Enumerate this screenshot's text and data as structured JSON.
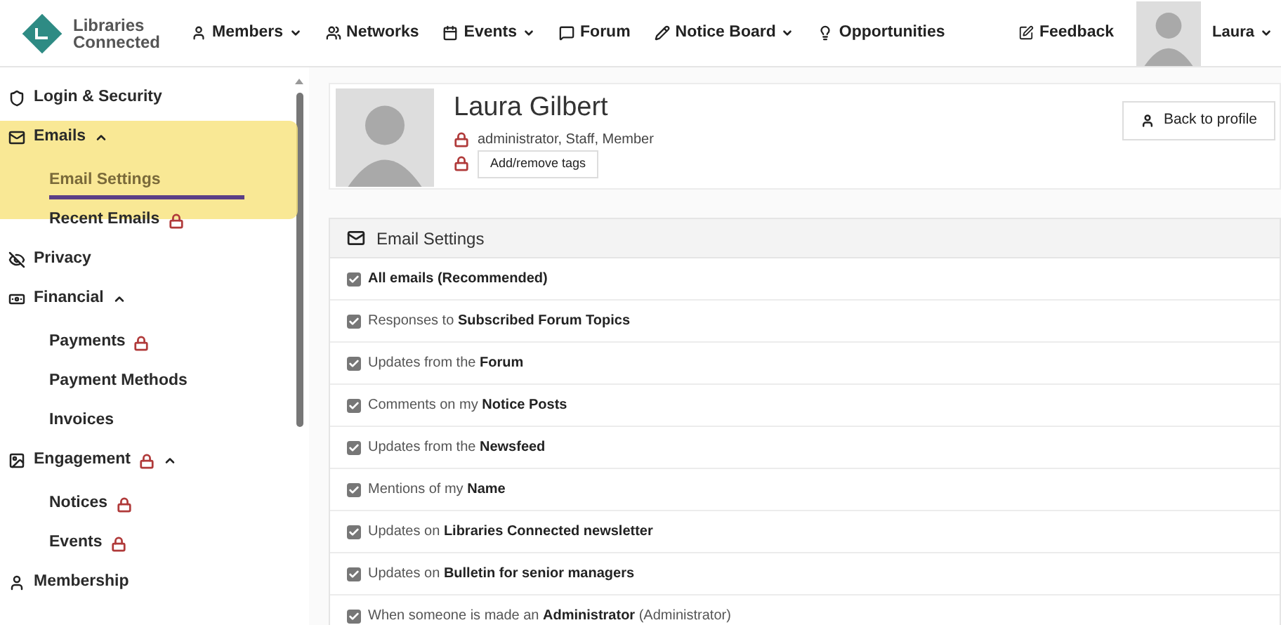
{
  "logo": {
    "line1": "Libraries",
    "line2": "Connected"
  },
  "nav": [
    {
      "label": "Members",
      "dropdown": true
    },
    {
      "label": "Networks",
      "dropdown": false
    },
    {
      "label": "Events",
      "dropdown": true
    },
    {
      "label": "Forum",
      "dropdown": false
    },
    {
      "label": "Notice Board",
      "dropdown": true
    },
    {
      "label": "Opportunities",
      "dropdown": false
    }
  ],
  "feedback": "Feedback",
  "user": {
    "name": "Laura"
  },
  "sidebar": {
    "items": [
      {
        "label": "Login & Security",
        "locked": false,
        "selected": false
      },
      {
        "label": "Emails",
        "locked": false,
        "expanded": true,
        "highlighted": true,
        "selected": false,
        "children": [
          {
            "label": "Email Settings",
            "locked": false,
            "selected": true
          },
          {
            "label": "Recent Emails",
            "locked": true,
            "selected": false
          }
        ]
      },
      {
        "label": "Privacy",
        "locked": false,
        "selected": false
      },
      {
        "label": "Financial",
        "locked": false,
        "expanded": true,
        "selected": false,
        "children": [
          {
            "label": "Payments",
            "locked": true,
            "selected": false
          },
          {
            "label": "Payment Methods",
            "locked": false,
            "selected": false
          },
          {
            "label": "Invoices",
            "locked": false,
            "selected": false
          }
        ]
      },
      {
        "label": "Engagement",
        "locked": true,
        "expanded": true,
        "selected": false,
        "children": [
          {
            "label": "Notices",
            "locked": true,
            "selected": false
          },
          {
            "label": "Events",
            "locked": true,
            "selected": false
          }
        ]
      },
      {
        "label": "Membership",
        "locked": false,
        "selected": false
      }
    ]
  },
  "profile": {
    "name": "Laura Gilbert",
    "tags": "administrator, Staff, Member",
    "tags_button": "Add/remove tags",
    "back_button": "Back to profile"
  },
  "email_settings": {
    "title": "Email Settings",
    "options": [
      {
        "text": "All emails (Recommended)",
        "bold": true,
        "checked": true
      },
      {
        "text": "Responses to **Subscribed Forum Topics**",
        "bold": false,
        "checked": true
      },
      {
        "text": "Updates from the **Forum**",
        "bold": false,
        "checked": true
      },
      {
        "text": "Comments on my **Notice Posts**",
        "bold": false,
        "checked": true
      },
      {
        "text": "Updates from the **Newsfeed**",
        "bold": false,
        "checked": true
      },
      {
        "text": "Mentions of my **Name**",
        "bold": false,
        "checked": true
      },
      {
        "text": "Updates on **Libraries Connected newsletter**",
        "bold": false,
        "checked": true
      },
      {
        "text": "Updates on **Bulletin for senior managers**",
        "bold": false,
        "checked": true
      },
      {
        "text": "When someone is made an **Administrator** (Administrator)",
        "bold": false,
        "checked": true
      }
    ]
  }
}
